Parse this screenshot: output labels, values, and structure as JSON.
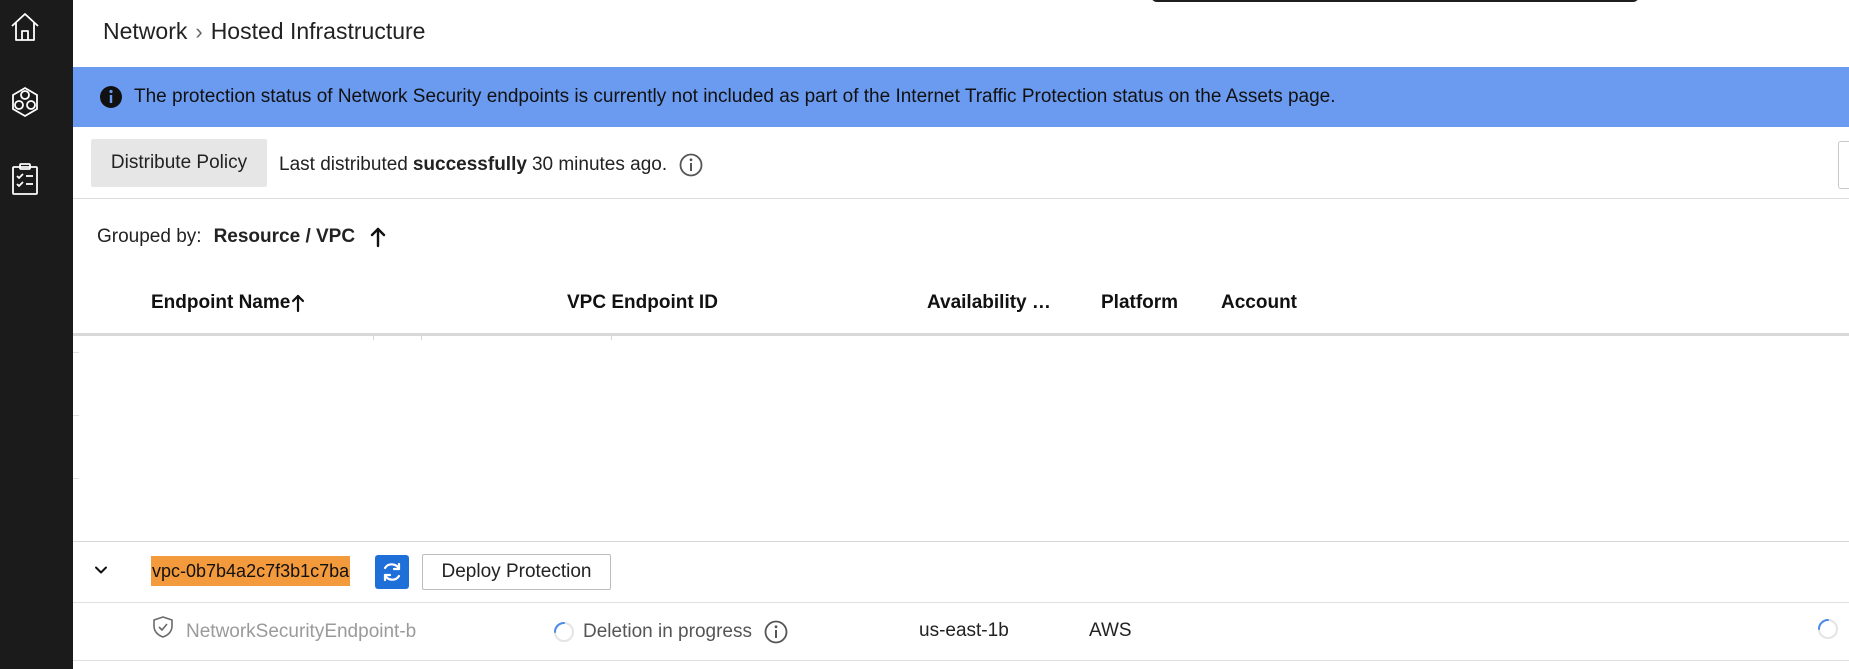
{
  "sidebar": {
    "items": [
      {
        "icon": "home-icon"
      },
      {
        "icon": "network-hexagon-icon"
      },
      {
        "icon": "checklist-icon"
      }
    ]
  },
  "breadcrumb": {
    "items": [
      "Network",
      "Hosted Infrastructure"
    ],
    "separator": "›"
  },
  "banner": {
    "icon": "info-icon",
    "text": "The protection status of Network Security endpoints is currently not included as part of the Internet Traffic Protection status on the Assets page.",
    "color": "#6b9bf0"
  },
  "toolbar": {
    "distribute_label": "Distribute Policy",
    "status_prefix": "Last distributed",
    "status_bold": "successfully",
    "status_suffix": "30 minutes ago."
  },
  "grouping": {
    "label": "Grouped by:",
    "value": "Resource / VPC",
    "sort": "ascending"
  },
  "table": {
    "columns": [
      "Endpoint Name",
      "VPC Endpoint ID",
      "Availability …",
      "Platform",
      "Account"
    ],
    "sorted_column": "Endpoint Name",
    "groups": [
      {
        "vpc_id": "vpc-0b7b4a2c7f3b1c7ba",
        "highlight_color": "#f39a3c",
        "deploy_label": "Deploy Protection",
        "rows": [
          {
            "endpoint_name": "NetworkSecurityEndpoint-b",
            "status": "Deletion in progress",
            "availability_zone": "us-east-1b",
            "platform": "AWS",
            "account": ""
          }
        ]
      }
    ]
  },
  "colors": {
    "sidebar": "#1b1b1b",
    "accent": "#1f6fd9"
  }
}
